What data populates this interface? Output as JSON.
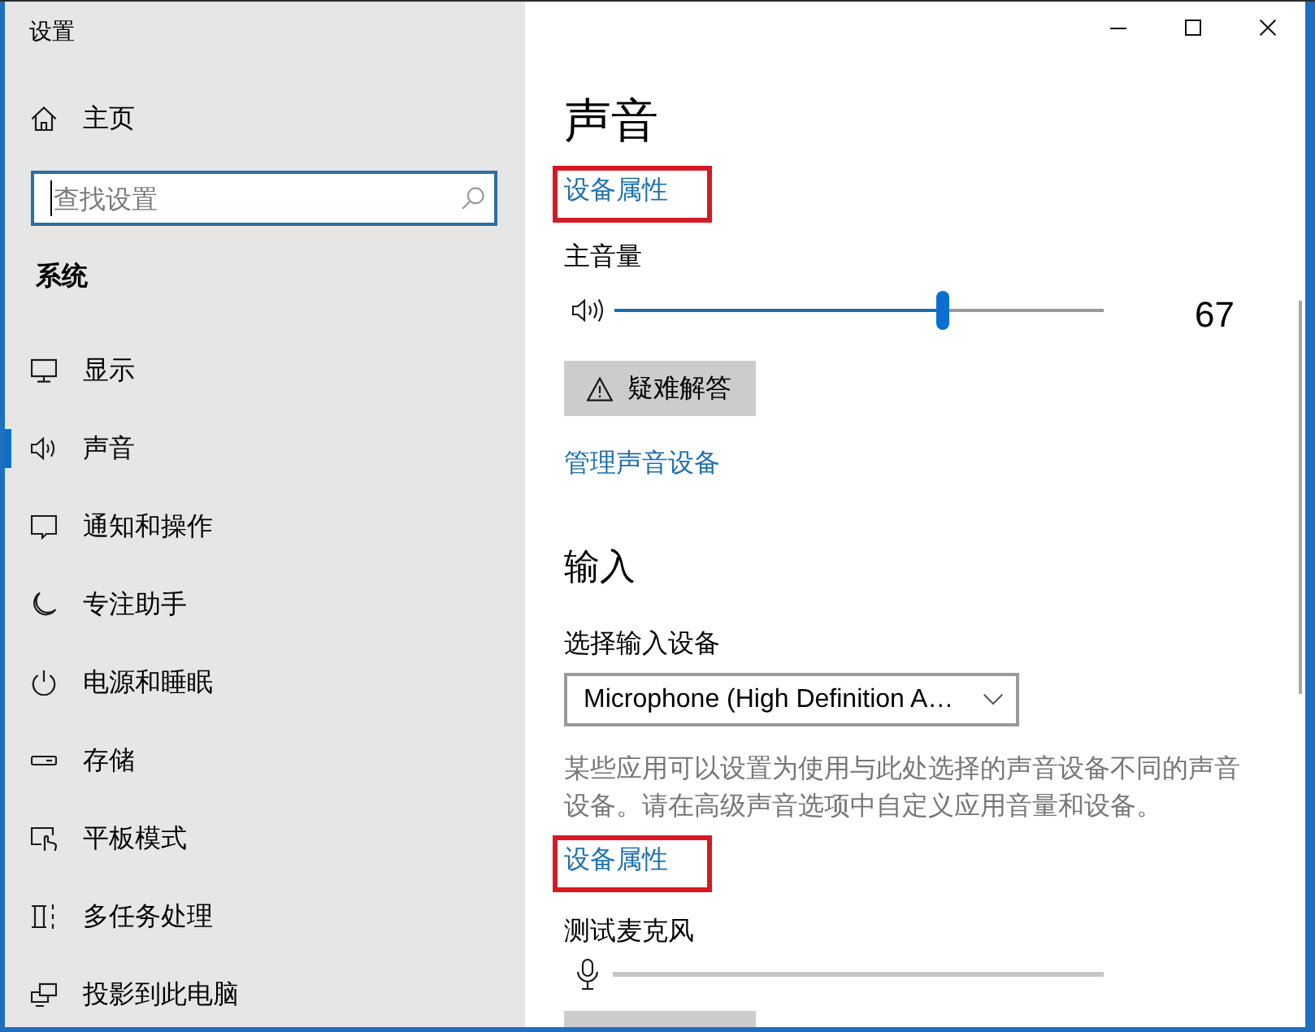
{
  "window": {
    "title": "设置"
  },
  "sidebar": {
    "home": {
      "label": "主页"
    },
    "search": {
      "placeholder": "查找设置",
      "focused": true
    },
    "section_title": "系统",
    "items": [
      {
        "kind": "display",
        "label": "显示",
        "selected": false
      },
      {
        "kind": "sound",
        "label": "声音",
        "selected": true
      },
      {
        "kind": "notifications",
        "label": "通知和操作",
        "selected": false
      },
      {
        "kind": "focus",
        "label": "专注助手",
        "selected": false
      },
      {
        "kind": "power",
        "label": "电源和睡眠",
        "selected": false
      },
      {
        "kind": "storage",
        "label": "存储",
        "selected": false
      },
      {
        "kind": "tablet",
        "label": "平板模式",
        "selected": false
      },
      {
        "kind": "multitasking",
        "label": "多任务处理",
        "selected": false
      },
      {
        "kind": "project",
        "label": "投影到此电脑",
        "selected": false
      }
    ]
  },
  "main": {
    "title": "声音",
    "output": {
      "properties_link": {
        "label": "设备属性",
        "highlighted": true
      },
      "volume": {
        "label": "主音量",
        "level": 0.67,
        "reading": "67"
      },
      "troubleshoot_button": {
        "label": "疑难解答"
      },
      "manage_link": "管理声音设备"
    },
    "input": {
      "title": "输入",
      "device_label": "选择输入设备",
      "device_dropdown": {
        "value": "Microphone (High Definition A…"
      },
      "note": "某些应用可以设置为使用与此处选择的声音设备不同的声音设备。请在高级声音选项中自定义应用音量和设备。",
      "properties_link": {
        "label": "设备属性",
        "highlighted": true
      },
      "test_microphone": {
        "label": "测试麦克风",
        "level": 0
      },
      "partial_button": true
    }
  }
}
